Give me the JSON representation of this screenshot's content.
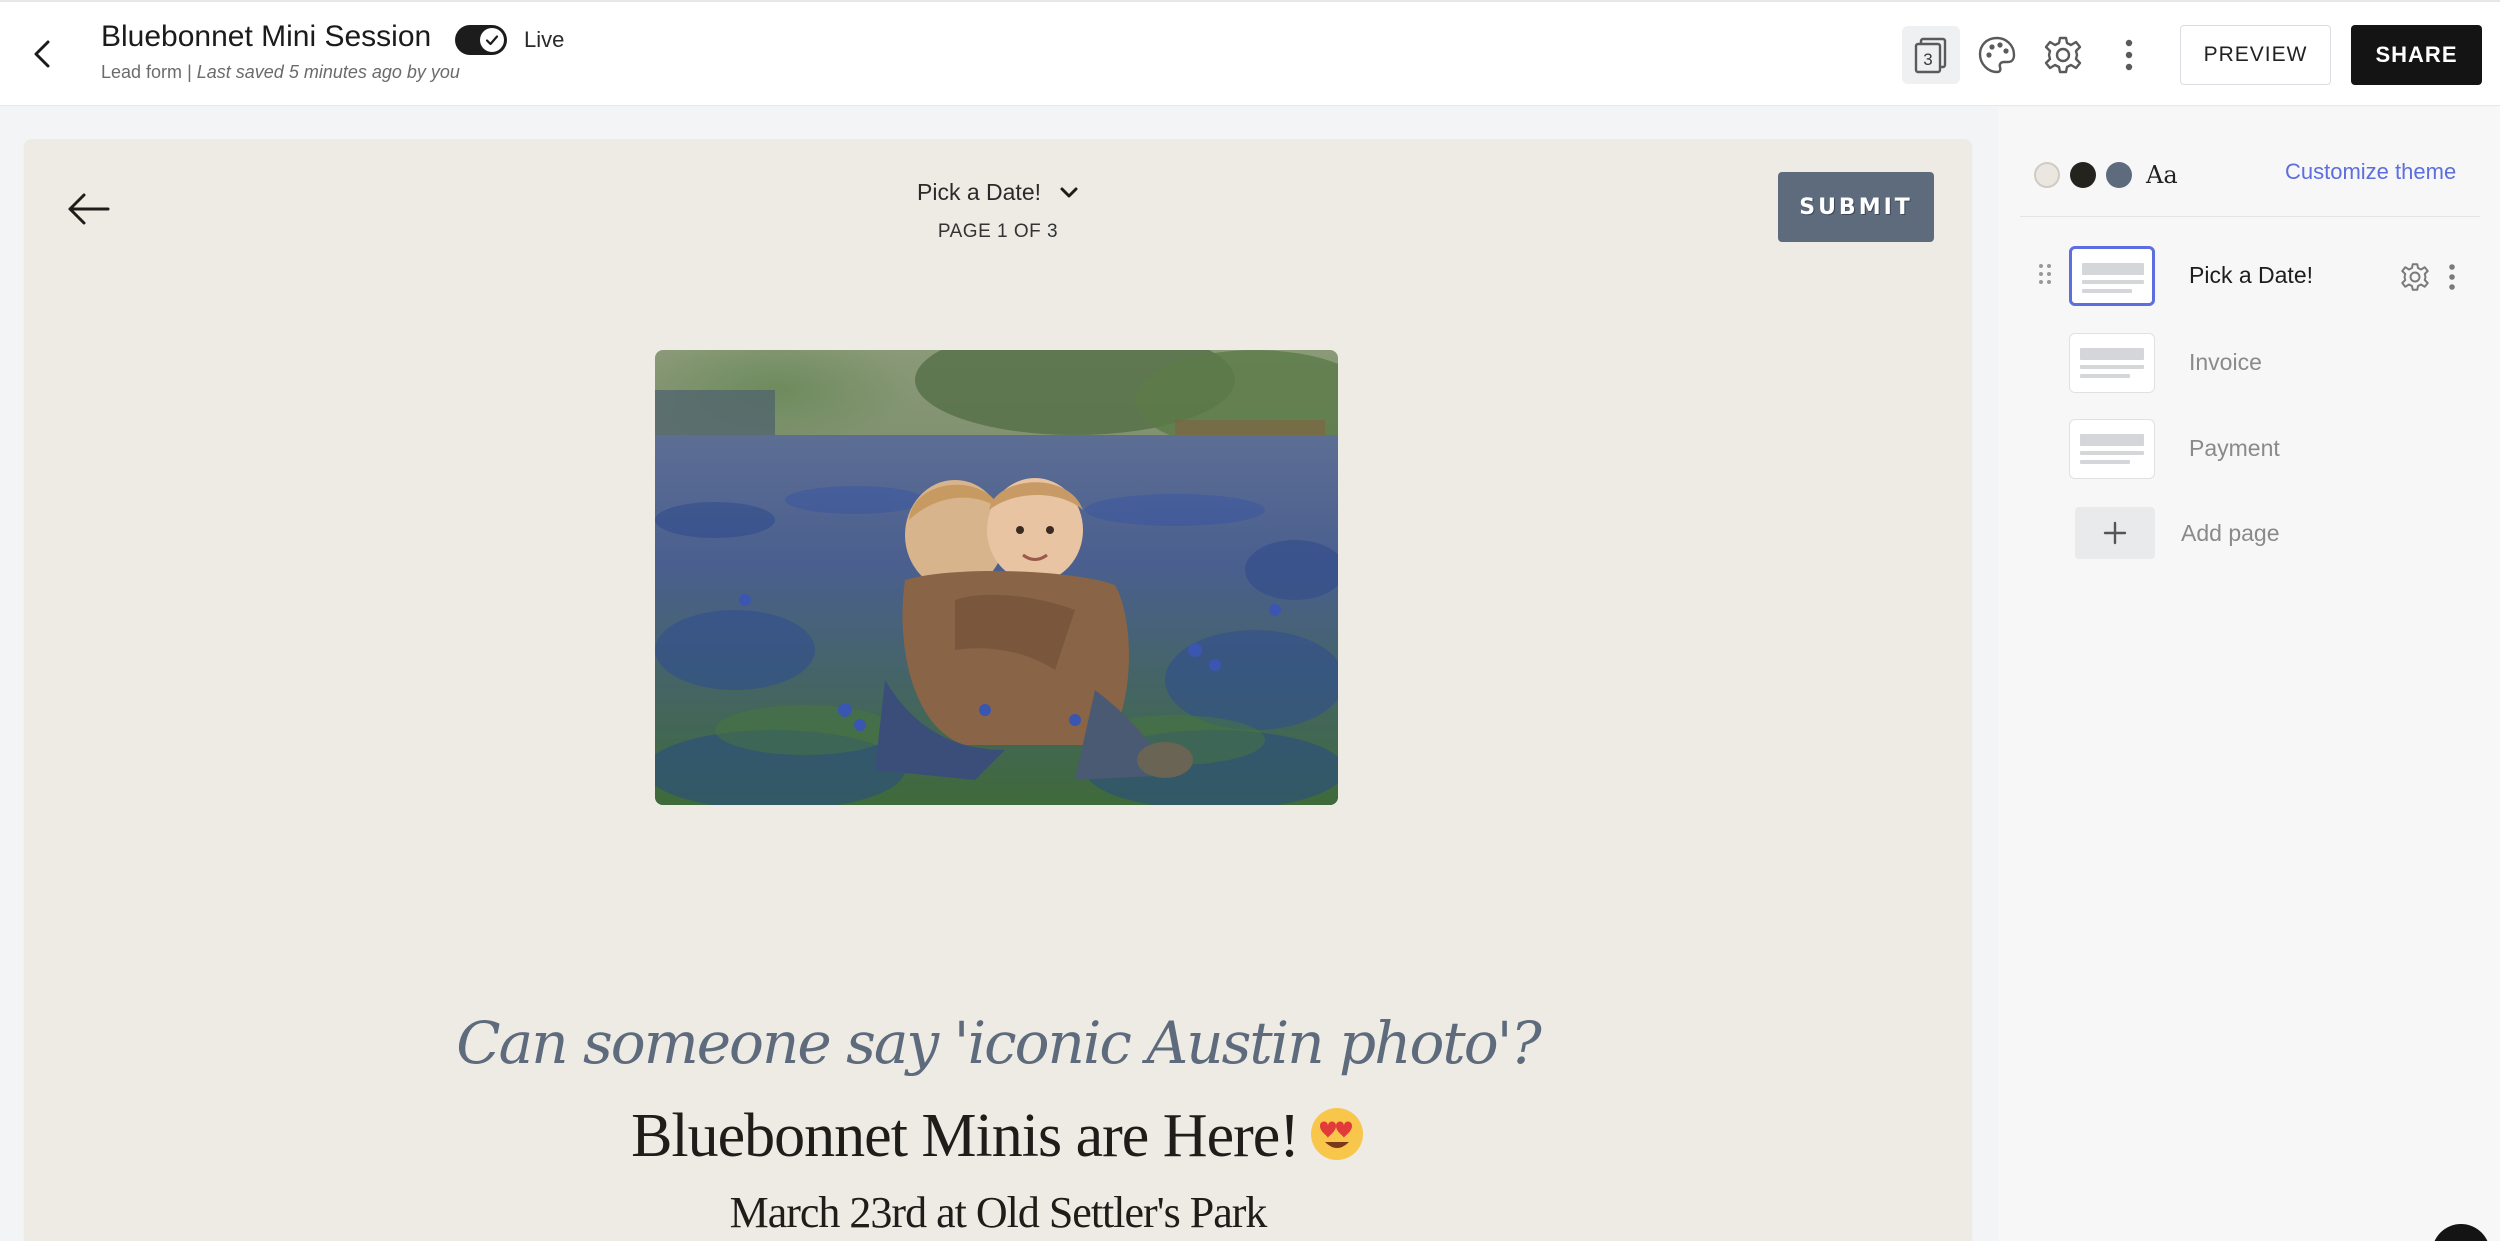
{
  "header": {
    "title": "Bluebonnet Mini Session",
    "form_type": "Lead form",
    "separator": "|",
    "last_saved": "Last saved 5 minutes ago by you",
    "live_label": "Live",
    "live_enabled": true,
    "page_count_badge": "3",
    "preview_label": "PREVIEW",
    "share_label": "SHARE"
  },
  "form": {
    "page_select_label": "Pick a Date!",
    "page_indicator": "PAGE 1 OF 3",
    "submit_label": "SUBMIT",
    "tagline": "Can someone say 'iconic Austin photo'?",
    "headline": "Bluebonnet Minis are Here!",
    "sub_headline": "March 23rd at Old Settler's Park"
  },
  "theme": {
    "swatches": [
      "#ebe7e0",
      "#25231e",
      "#5d6b7d"
    ],
    "font_preview": "Aa",
    "customize_label": "Customize theme",
    "accent": "#5c6ee0"
  },
  "pages": {
    "items": [
      {
        "label": "Pick a Date!",
        "active": true
      },
      {
        "label": "Invoice",
        "active": false
      },
      {
        "label": "Payment",
        "active": false
      }
    ],
    "add_label": "Add page"
  }
}
